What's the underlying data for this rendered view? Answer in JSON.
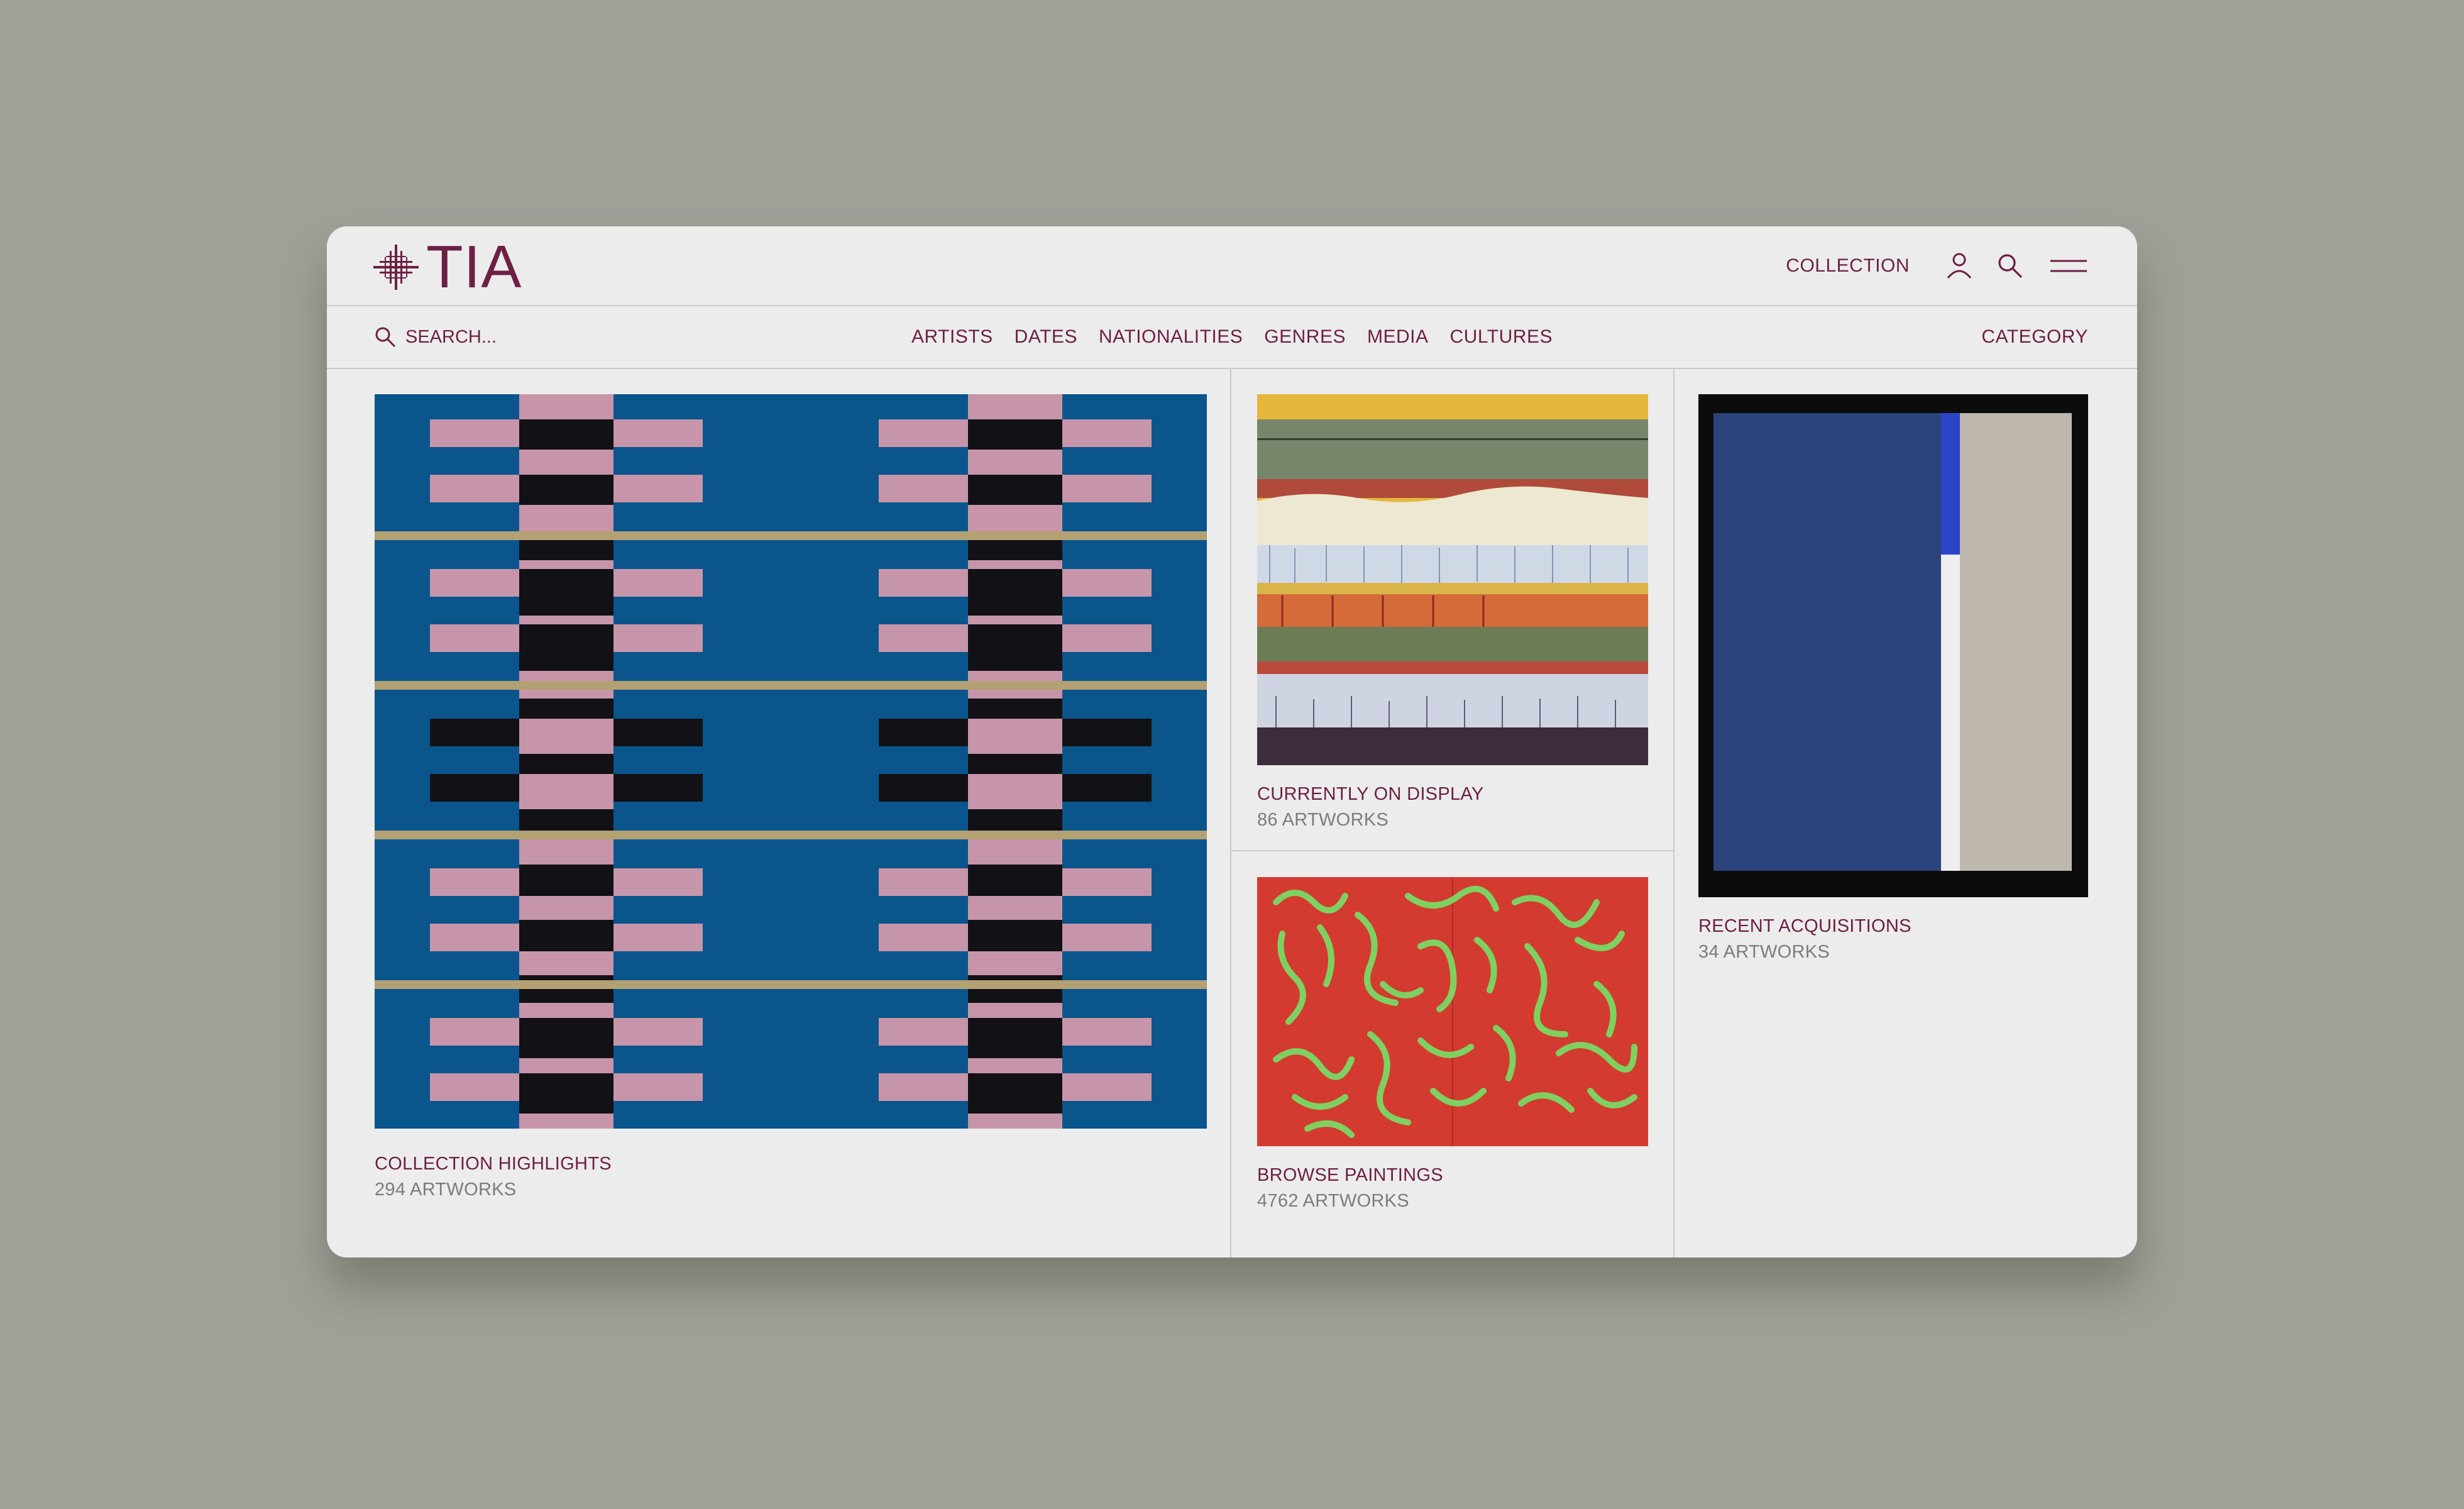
{
  "app": {
    "logo_text": "TIA",
    "brand_color": "#6d1f44",
    "background_color": "#a0a098"
  },
  "header": {
    "collection_label": "COLLECTION",
    "icons": [
      "user-icon",
      "search-icon",
      "menu-icon"
    ]
  },
  "filterbar": {
    "search_placeholder": "SEARCH...",
    "filters": [
      "ARTISTS",
      "DATES",
      "NATIONALITIES",
      "GENRES",
      "MEDIA",
      "CULTURES"
    ],
    "category_label": "CATEGORY"
  },
  "cards": [
    {
      "title": "COLLECTION HIGHLIGHTS",
      "count": "294 ARTWORKS"
    },
    {
      "title": "CURRENTLY ON DISPLAY",
      "count": "86 ARTWORKS"
    },
    {
      "title": "BROWSE PAINTINGS",
      "count": "4762 ARTWORKS"
    },
    {
      "title": "RECENT ACQUISITIONS",
      "count": "34 ARTWORKS"
    }
  ]
}
